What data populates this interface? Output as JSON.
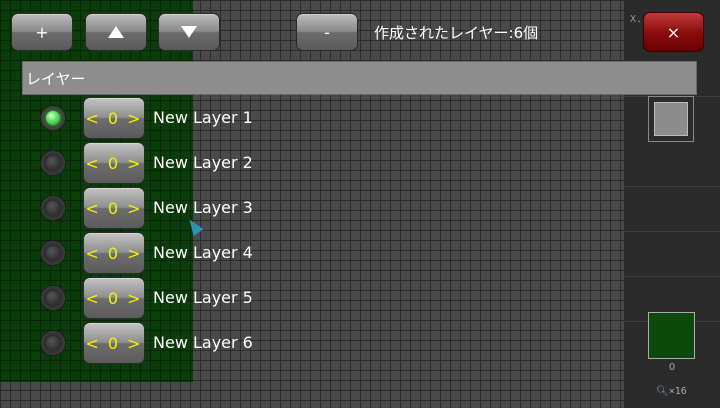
{
  "toolbar": {
    "add_label": "+",
    "remove_label": "-",
    "close_label": "×",
    "layer_count_label": "作成されたレイヤー:6個"
  },
  "header": {
    "title": "レイヤー"
  },
  "layers": [
    {
      "visibility_label": "< 0 >",
      "name": "New Layer 1",
      "selected": true
    },
    {
      "visibility_label": "< 0 >",
      "name": "New Layer 2",
      "selected": false
    },
    {
      "visibility_label": "< 0 >",
      "name": "New Layer 3",
      "selected": false
    },
    {
      "visibility_label": "< 0 >",
      "name": "New Layer 4",
      "selected": false
    },
    {
      "visibility_label": "< 0 >",
      "name": "New Layer 5",
      "selected": false
    },
    {
      "visibility_label": "< 0 >",
      "name": "New Layer 6",
      "selected": false
    }
  ],
  "side": {
    "coord_text": "X.",
    "color_value": "0",
    "zoom_text": "×16"
  },
  "colors": {
    "canvas_fill": "#0b3d0b",
    "selected_radio": "#5ae05a",
    "visibility_text": "#f2f200",
    "close_button": "#8a0e0e"
  }
}
